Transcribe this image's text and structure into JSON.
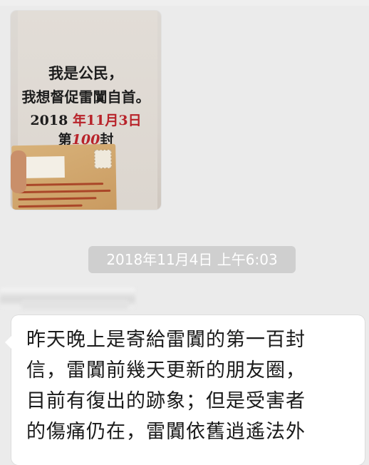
{
  "photo": {
    "lines": [
      "我是公民，",
      "我想督促雷闐自首。"
    ],
    "date_prefix": "2018",
    "date_suffix": "年11月3日",
    "count_prefix": "第",
    "count_number": "100",
    "count_suffix": "封",
    "ink_color": "#1d1d1d",
    "accent_color": "#b8232a"
  },
  "timestamp": "2018年11月4日 上午6:03",
  "message": {
    "lines": [
      "昨天晚上是寄給雷闐的第一百封",
      "信，雷闐前幾天更新的朋友圈，",
      "目前有復出的跡象；但是受害者",
      "的傷痛仍在，雷闐依舊逍遙法外"
    ]
  },
  "colors": {
    "background": "#ebebeb",
    "bubble": "#ffffff",
    "timestamp_bg": "#cfcfcf"
  }
}
